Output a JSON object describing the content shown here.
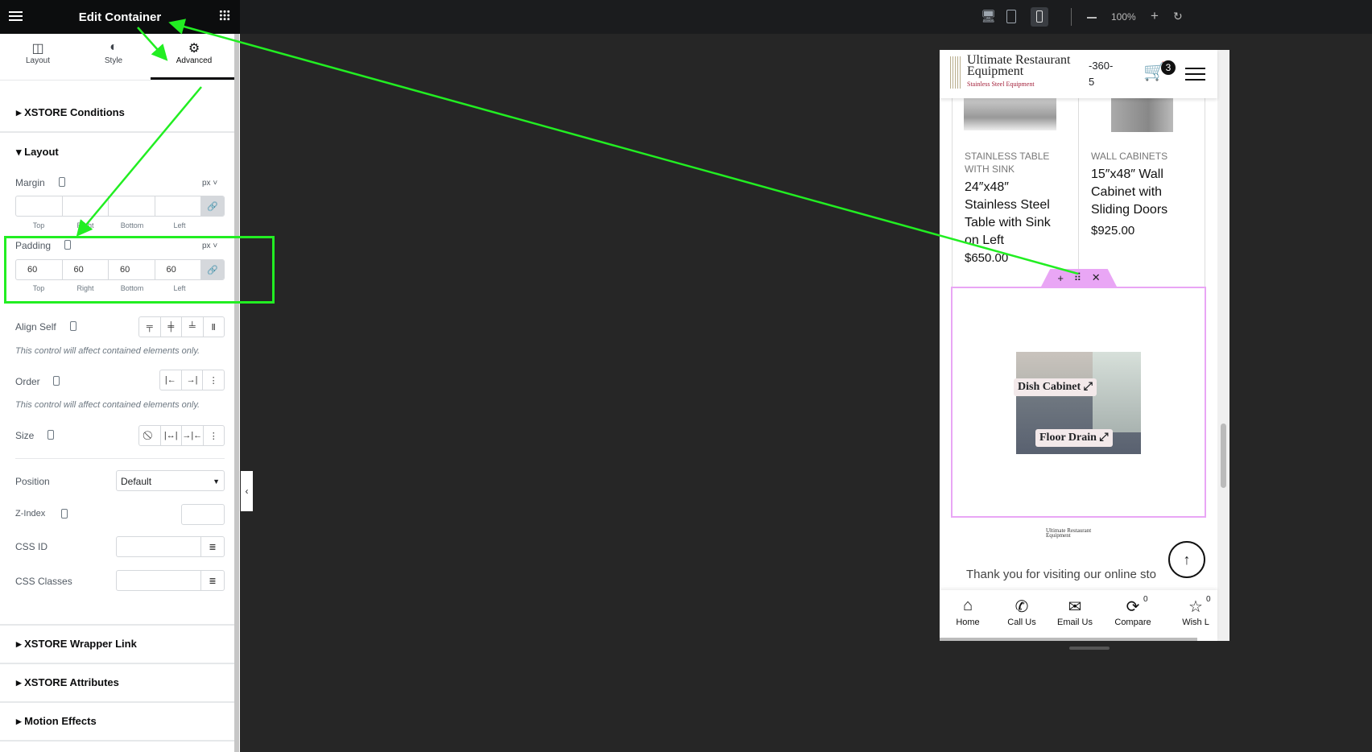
{
  "header": {
    "title": "Edit Container",
    "menu_icon": "hamburger-icon",
    "apps_icon": "grid-icon"
  },
  "tabs": [
    {
      "label": "Layout",
      "icon": "columns-icon"
    },
    {
      "label": "Style",
      "icon": "contrast-icon"
    },
    {
      "label": "Advanced",
      "icon": "gear-icon",
      "active": true
    }
  ],
  "sections": {
    "xstore_conditions": "XSTORE Conditions",
    "layout": "Layout",
    "wrapper_link": "XSTORE Wrapper Link",
    "attributes": "XSTORE Attributes",
    "motion": "Motion Effects"
  },
  "margin": {
    "label": "Margin",
    "unit": "px",
    "values": [
      "",
      "",
      "",
      ""
    ],
    "sides": [
      "Top",
      "Right",
      "Bottom",
      "Left"
    ]
  },
  "padding": {
    "label": "Padding",
    "unit": "px",
    "values": [
      "60",
      "60",
      "60",
      "60"
    ],
    "sides": [
      "Top",
      "Right",
      "Bottom",
      "Left"
    ]
  },
  "align_self": {
    "label": "Align Self",
    "note": "This control will affect contained elements only."
  },
  "order": {
    "label": "Order",
    "note": "This control will affect contained elements only."
  },
  "size": {
    "label": "Size"
  },
  "position": {
    "label": "Position",
    "value": "Default"
  },
  "zindex": {
    "label": "Z-Index",
    "value": ""
  },
  "css_id": {
    "label": "CSS ID",
    "value": ""
  },
  "css_classes": {
    "label": "CSS Classes",
    "value": ""
  },
  "toolbar": {
    "zoom": "100%"
  },
  "site": {
    "logo_title_1": "Ultimate Restaurant",
    "logo_title_2": "Equipment",
    "logo_tagline": "Stainless Steel Equipment",
    "phone_1": "-360-",
    "phone_2": "5",
    "cart_count": "3",
    "products": [
      {
        "category_1": "STAINLESS TABLE",
        "category_2": "WITH SINK",
        "title": [
          "24″x48″",
          "Stainless Steel",
          "Table with Sink",
          "on Left"
        ],
        "price": "$650.00"
      },
      {
        "category_1": "WALL CABINETS",
        "category_2": "",
        "title": [
          "15″x48″ Wall",
          "Cabinet with",
          "Sliding Doors"
        ],
        "price": "$925.00"
      }
    ],
    "hotspots": [
      "Dish Cabinet",
      "Floor Drain"
    ],
    "footer_text": "Thank you for visiting our online sto",
    "nav": [
      {
        "label": "Home",
        "icon": "home-icon"
      },
      {
        "label": "Call Us",
        "icon": "phone-icon"
      },
      {
        "label": "Email Us",
        "icon": "mail-icon"
      },
      {
        "label": "Compare",
        "icon": "compare-icon",
        "count": "0"
      },
      {
        "label": "Wish L",
        "icon": "star-icon",
        "count": "0"
      }
    ]
  },
  "colors": {
    "accent_selection": "#e9a6f5",
    "annotation": "#22ee22"
  }
}
